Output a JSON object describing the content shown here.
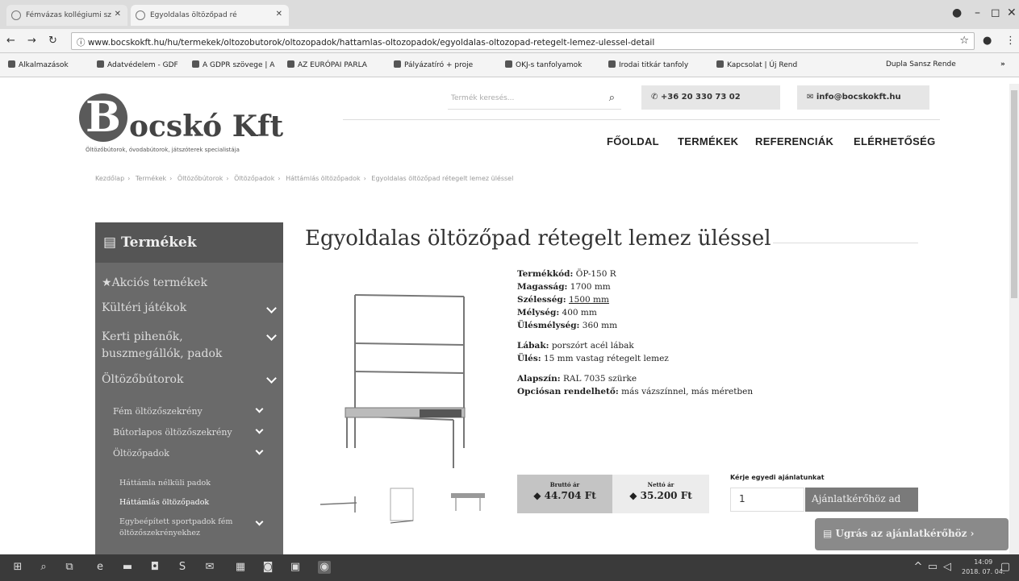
{
  "browser": {
    "tabs": [
      {
        "label": "Fémvázas kollégiumi sz"
      },
      {
        "label": "Egyoldalas öltözőpad ré"
      }
    ],
    "url": "www.bocskokft.hu/hu/termekek/oltozobutorok/oltozopadok/hattamlas-oltozopadok/egyoldalas-oltozopad-retegelt-lemez-ulessel-detail",
    "bookmarks": [
      "Alkalmazások",
      "Adatvédelem - GDF",
      "A GDPR szövege | A",
      "AZ EURÓPAI PARLA",
      "Pályázatíró + proje",
      "OKJ-s tanfolyamok",
      "Irodai titkár tanfoly",
      "Kapcsolat | Új Rend",
      "Dupla Sansz Rende"
    ]
  },
  "site": {
    "logo_initial": "B",
    "logo_name": "ocskó Kft",
    "logo_tagline": "Öltözőbútorok, óvodabútorok, játszóterek specialistája",
    "search_placeholder": "Termék keresés...",
    "phone": "+36 20 330 73 02",
    "email": "info@bocskokft.hu",
    "menu": [
      "FŐOLDAL",
      "TERMÉKEK",
      "REFERENCIÁK",
      "ELÉRHETŐSÉG"
    ],
    "breadcrumbs": [
      "Kezdőlap",
      "Termékek",
      "Öltözőbútorok",
      "Öltözőpadok",
      "Háttámlás öltözőpadok",
      "Egyoldalas öltözőpad rétegelt lemez üléssel"
    ]
  },
  "sidebar": {
    "title": "Termékek",
    "items": [
      {
        "label": "Akciós termékek"
      },
      {
        "label": "Kültéri játékok"
      },
      {
        "label": "Kerti pihenők,"
      },
      {
        "label": "buszmegállók, padok"
      },
      {
        "label": "Öltözőbútorok"
      },
      {
        "label": "Fém öltözőszekrény"
      },
      {
        "label": "Bútorlapos öltözőszekrény"
      },
      {
        "label": "Öltözőpadok"
      },
      {
        "label": "Háttámla nélküli padok"
      },
      {
        "label": "Háttámlás öltözőpadok"
      },
      {
        "label": "Egybeépített sportpadok fém"
      },
      {
        "label": "öltözőszekrényekhez"
      }
    ]
  },
  "product": {
    "title": "Egyoldalas öltözőpad rétegelt lemez üléssel",
    "specs": [
      {
        "label": "Termékkód:",
        "value": "ÖP-150 R"
      },
      {
        "label": "Magasság:",
        "value": "1700 mm"
      },
      {
        "label": "Szélesség:",
        "value": "1500 mm"
      },
      {
        "label": "Mélység:",
        "value": "400 mm"
      },
      {
        "label": "Ülésmélység:",
        "value": "360 mm"
      },
      {
        "label": "Lábak:",
        "value": "porszórt acél lábak"
      },
      {
        "label": "Ülés:",
        "value": "15 mm vastag rétegelt lemez"
      },
      {
        "label": "Alapszín:",
        "value": "RAL 7035 szürke"
      },
      {
        "label": "Opciósan rendelhető:",
        "value": "más vázszínnel, más méretben"
      }
    ],
    "gross_label": "Bruttó ár",
    "gross_price": "44.704 Ft",
    "net_label": "Nettó ár",
    "net_price": "35.200 Ft",
    "request_label": "Kérje egyedi ajánlatunkat",
    "quantity": "1",
    "quote_button": "Ajánlatkérőhöz ad",
    "jump_button": "Ugrás az ajánlatkérőhöz"
  },
  "taskbar": {
    "time": "14:09",
    "date": "2018. 07. 04."
  },
  "colors": {
    "sidebar_bg": "#6a6a6a",
    "sidebar_head": "#555555",
    "button_bg": "#7a7a7a"
  }
}
